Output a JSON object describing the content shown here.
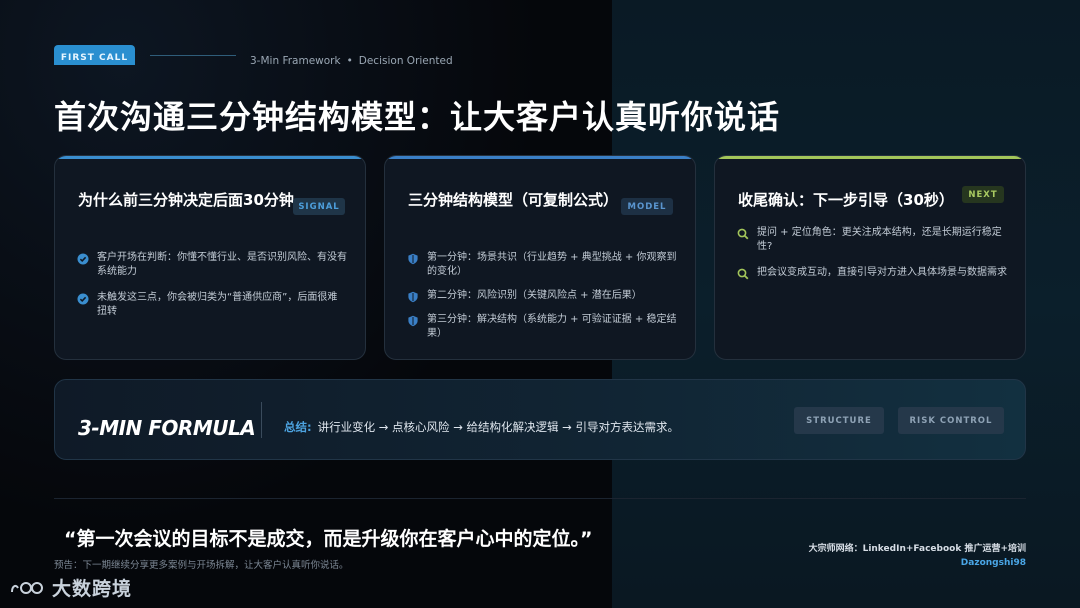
{
  "header": {
    "tag": "FIRST CALL",
    "subtitle_left": "3-Min Framework",
    "subtitle_dot": "•",
    "subtitle_right": "Decision Oriented",
    "title": "首次沟通三分钟结构模型：让大客户认真听你说话"
  },
  "cards": [
    {
      "title": "为什么前三分钟决定后面30分钟",
      "tag": "SIGNAL",
      "accent": "#3a8ecf",
      "icon": "check-circle-icon",
      "items": [
        "客户开场在判断：你懂不懂行业、是否识别风险、有没有系统能力",
        "未触发这三点，你会被归类为“普通供应商”，后面很难扭转"
      ]
    },
    {
      "title": "三分钟结构模型（可复制公式）",
      "tag": "MODEL",
      "accent": "#3a7fc6",
      "icon": "shield-icon",
      "items": [
        "第一分钟：场景共识（行业趋势 + 典型挑战 + 你观察到的变化）",
        "第二分钟：风险识别（关键风险点 + 潜在后果）",
        "第三分钟：解决结构（系统能力 + 可验证证据 + 稳定结果）"
      ]
    },
    {
      "title": "收尾确认：下一步引导（30秒）",
      "tag": "NEXT",
      "accent": "#a3c65a",
      "icon": "search-icon",
      "items": [
        "提问 + 定位角色：更关注成本结构，还是长期运行稳定性?",
        "把会议变成互动，直接引导对方进入具体场景与数据需求"
      ]
    }
  ],
  "formula": {
    "title": "3-MIN FORMULA",
    "label": "总结:",
    "text": "讲行业变化 → 点核心风险 → 给结构化解决逻辑 → 引导对方表达需求。",
    "buttons": [
      "STRUCTURE",
      "RISK CONTROL"
    ]
  },
  "footer": {
    "quote": "“第一次会议的目标不是成交，而是升级你在客户心中的定位。”",
    "preview": "预告：下一期继续分享更多案例与开场拆解，让大客户认真听你说话。",
    "brand_line1": "大宗师网络：LinkedIn+Facebook 推广运营+培训",
    "brand_line2": "Dazongshi98",
    "logo_text": "大数跨境"
  }
}
